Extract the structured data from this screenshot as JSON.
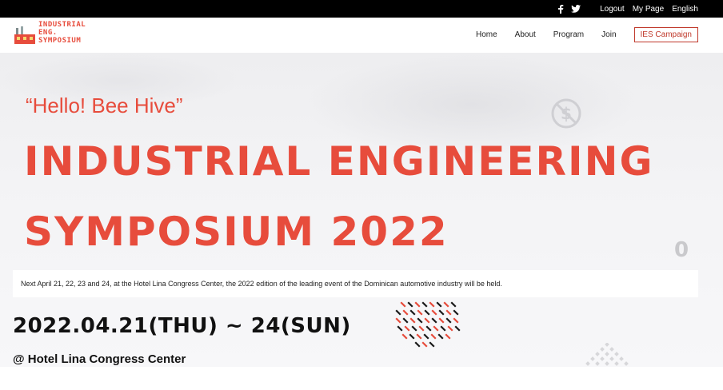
{
  "topbar": {
    "social": [
      {
        "icon": "facebook-icon",
        "glyph": "f"
      },
      {
        "icon": "twitter-icon",
        "glyph": "t"
      }
    ],
    "links": [
      "Logout",
      "My Page",
      "English"
    ]
  },
  "logo": {
    "lines": [
      "INDUSTRIAL",
      "ENG.",
      "SYMPOSIUM"
    ]
  },
  "nav": {
    "items": [
      "Home",
      "About",
      "Program",
      "Join"
    ],
    "campaign": "IES Campaign"
  },
  "hero": {
    "greeting": "“Hello! Bee Hive”",
    "title_line1": "INDUSTRIAL ENGINEERING",
    "title_line2": "SYMPOSIUM 2022",
    "description": "Next April 21, 22, 23 and 24, at the Hotel Lina Congress Center, the 2022 edition of the leading event of the Dominican automotive industry will be held.",
    "date": "2022.04.21(THU) ~ 24(SUN)",
    "venue": "@ Hotel Lina Congress Center",
    "decor_glyph": "0"
  },
  "colors": {
    "accent": "#e74c3c",
    "campaign_border": "#c0392b",
    "topbar": "#000000"
  }
}
